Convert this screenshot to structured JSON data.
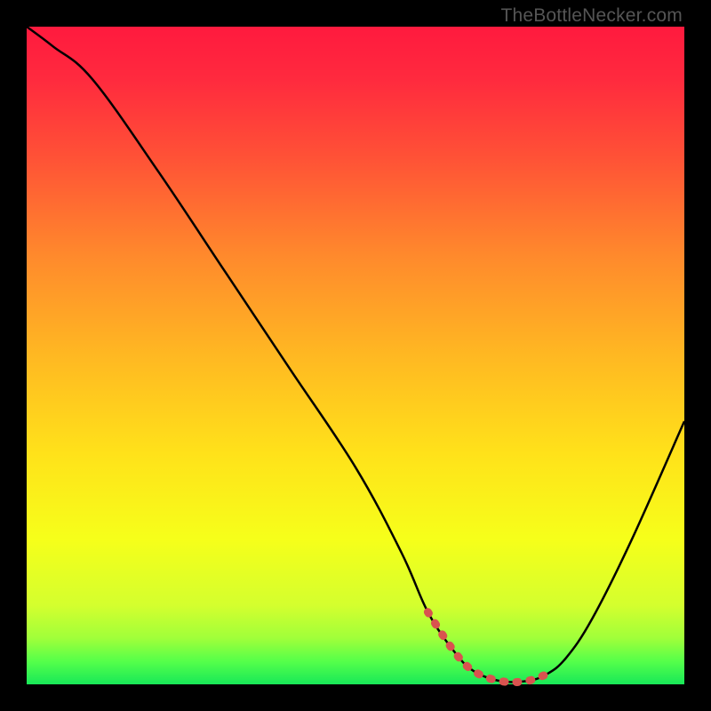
{
  "watermark": "TheBottleNecker.com",
  "chart_data": {
    "type": "line",
    "title": "",
    "xlabel": "",
    "ylabel": "",
    "xlim": [
      0,
      100
    ],
    "ylim": [
      0,
      100
    ],
    "series": [
      {
        "name": "bottleneck-curve",
        "x": [
          0,
          4,
          10,
          20,
          30,
          40,
          50,
          57,
          61,
          65,
          68,
          72,
          76,
          79,
          82,
          86,
          92,
          100
        ],
        "values": [
          100,
          97,
          92,
          78,
          63,
          48,
          33,
          20,
          11,
          5,
          2,
          0.5,
          0.5,
          1.5,
          4,
          10,
          22,
          40
        ]
      }
    ],
    "highlight_band": {
      "name": "optimal-range",
      "x": [
        61,
        65,
        68,
        72,
        76,
        79
      ],
      "values": [
        11,
        5,
        2,
        0.5,
        0.5,
        1.5
      ]
    },
    "background_gradient": {
      "stops": [
        {
          "offset": 0.0,
          "color": "#ff1a3e"
        },
        {
          "offset": 0.08,
          "color": "#ff2a3e"
        },
        {
          "offset": 0.2,
          "color": "#ff5236"
        },
        {
          "offset": 0.35,
          "color": "#ff8a2c"
        },
        {
          "offset": 0.5,
          "color": "#ffb822"
        },
        {
          "offset": 0.65,
          "color": "#ffe21a"
        },
        {
          "offset": 0.78,
          "color": "#f6ff1a"
        },
        {
          "offset": 0.88,
          "color": "#d4ff2e"
        },
        {
          "offset": 0.93,
          "color": "#a0ff3a"
        },
        {
          "offset": 0.965,
          "color": "#55ff4a"
        },
        {
          "offset": 1.0,
          "color": "#18e858"
        }
      ]
    }
  }
}
